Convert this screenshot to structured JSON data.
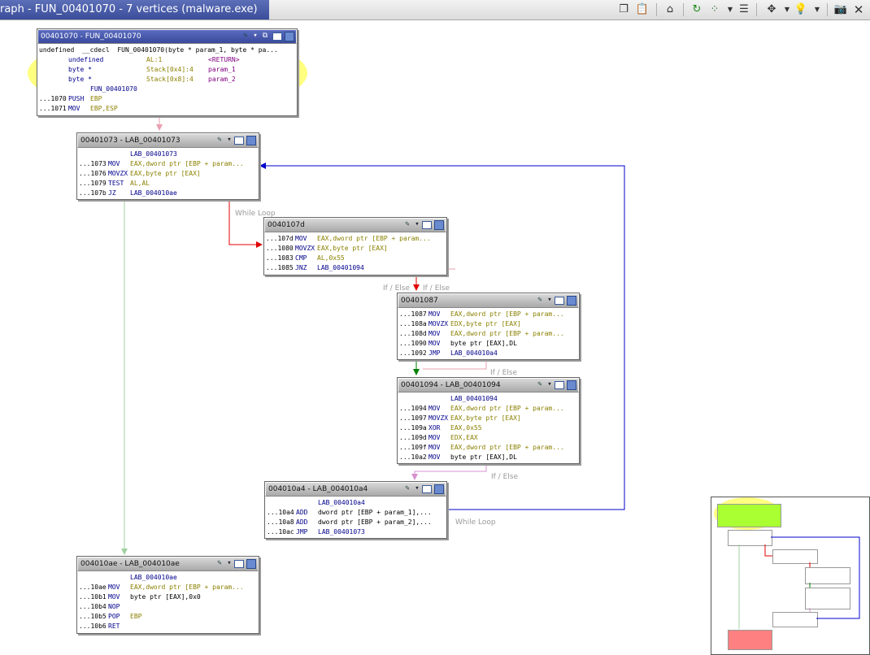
{
  "window": {
    "title": "raph - FUN_00401070 - 7 vertices  (malware.exe)",
    "toolbar_icons": [
      "copy-icon",
      "paste-icon",
      "home-icon",
      "refresh-icon",
      "layout-icon",
      "dropdown-icon",
      "table-icon",
      "move-icon",
      "dropdown-icon",
      "lightbulb-icon",
      "dropdown-icon",
      "snapshot-icon",
      "close-icon"
    ]
  },
  "blocks": {
    "entry": {
      "title": "00401070 - FUN_00401070",
      "sig": "undefined  __cdecl  FUN_00401070(byte * param_1, byte * pa...",
      "vars": [
        {
          "type": "undefined",
          "loc": "AL:1",
          "name": "<RETURN>"
        },
        {
          "type": "byte *",
          "loc": "Stack[0x4]:4",
          "name": "param_1"
        },
        {
          "type": "byte *",
          "loc": "Stack[0x8]:4",
          "name": "param_2"
        }
      ],
      "label": "FUN_00401070",
      "lines": [
        {
          "addr": "...1070",
          "mn": "PUSH",
          "op": "EBP"
        },
        {
          "addr": "...1071",
          "mn": "MOV",
          "op": "EBP,ESP"
        }
      ]
    },
    "b1073": {
      "title": "00401073 - LAB_00401073",
      "label": "LAB_00401073",
      "lines": [
        {
          "addr": "...1073",
          "mn": "MOV",
          "op": "EAX,dword ptr [EBP + param..."
        },
        {
          "addr": "...1076",
          "mn": "MOVZX",
          "op": "EAX,byte ptr [EAX]"
        },
        {
          "addr": "...1079",
          "mn": "TEST",
          "op": "AL,AL"
        },
        {
          "addr": "...107b",
          "mn": "JZ",
          "op": "LAB_004010ae"
        }
      ]
    },
    "b107d": {
      "title": "0040107d",
      "lines": [
        {
          "addr": "...107d",
          "mn": "MOV",
          "op": "EAX,dword ptr [EBP + param..."
        },
        {
          "addr": "...1080",
          "mn": "MOVZX",
          "op": "EAX,byte ptr [EAX]"
        },
        {
          "addr": "...1083",
          "mn": "CMP",
          "op": "AL,0x55"
        },
        {
          "addr": "...1085",
          "mn": "JNZ",
          "op": "LAB_00401094"
        }
      ]
    },
    "b1087": {
      "title": "00401087",
      "lines": [
        {
          "addr": "...1087",
          "mn": "MOV",
          "op": "EAX,dword ptr [EBP + param..."
        },
        {
          "addr": "...108a",
          "mn": "MOVZX",
          "op": "EDX,byte ptr [EAX]"
        },
        {
          "addr": "...108d",
          "mn": "MOV",
          "op": "EAX,dword ptr [EBP + param..."
        },
        {
          "addr": "...1090",
          "mn": "MOV",
          "op": "byte ptr [EAX],DL"
        },
        {
          "addr": "...1092",
          "mn": "JMP",
          "op": "LAB_004010a4"
        }
      ]
    },
    "b1094": {
      "title": "00401094 - LAB_00401094",
      "label": "LAB_00401094",
      "lines": [
        {
          "addr": "...1094",
          "mn": "MOV",
          "op": "EAX,dword ptr [EBP + param..."
        },
        {
          "addr": "...1097",
          "mn": "MOVZX",
          "op": "EAX,byte ptr [EAX]"
        },
        {
          "addr": "...109a",
          "mn": "XOR",
          "op": "EAX,0x55"
        },
        {
          "addr": "...109d",
          "mn": "MOV",
          "op": "EDX,EAX"
        },
        {
          "addr": "...109f",
          "mn": "MOV",
          "op": "EAX,dword ptr [EBP + param..."
        },
        {
          "addr": "...10a2",
          "mn": "MOV",
          "op": "byte ptr [EAX],DL"
        }
      ]
    },
    "b10a4": {
      "title": "004010a4 - LAB_004010a4",
      "label": "LAB_004010a4",
      "lines": [
        {
          "addr": "...10a4",
          "mn": "ADD",
          "op": "dword ptr [EBP + param_1],..."
        },
        {
          "addr": "...10a8",
          "mn": "ADD",
          "op": "dword ptr [EBP + param_2],..."
        },
        {
          "addr": "...10ac",
          "mn": "JMP",
          "op": "LAB_00401073"
        }
      ]
    },
    "b10ae": {
      "title": "004010ae - LAB_004010ae",
      "label": "LAB_004010ae",
      "lines": [
        {
          "addr": "...10ae",
          "mn": "MOV",
          "op": "EAX,dword ptr [EBP + param..."
        },
        {
          "addr": "...10b1",
          "mn": "MOV",
          "op": "byte ptr [EAX],0x0"
        },
        {
          "addr": "...10b4",
          "mn": "NOP",
          "op": ""
        },
        {
          "addr": "...10b5",
          "mn": "POP",
          "op": "EBP"
        },
        {
          "addr": "...10b6",
          "mn": "RET",
          "op": ""
        }
      ]
    }
  },
  "edge_labels": {
    "while_loop_1": "While Loop",
    "if_else_1": "If / Else",
    "if_else_2": "If / Else",
    "if_else_3": "If / Else",
    "if_else_4": "If / Else",
    "while_loop_2": "While Loop"
  },
  "colors": {
    "selected_header": "#3a4b9c",
    "highlight": "#ffff55",
    "edge_fallthrough": "#e8a0b0",
    "edge_true": "#e00000",
    "edge_false": "#008000",
    "edge_loop": "#0000cc",
    "minimap_entry": "#aaff33",
    "minimap_exit": "#ff8080"
  }
}
